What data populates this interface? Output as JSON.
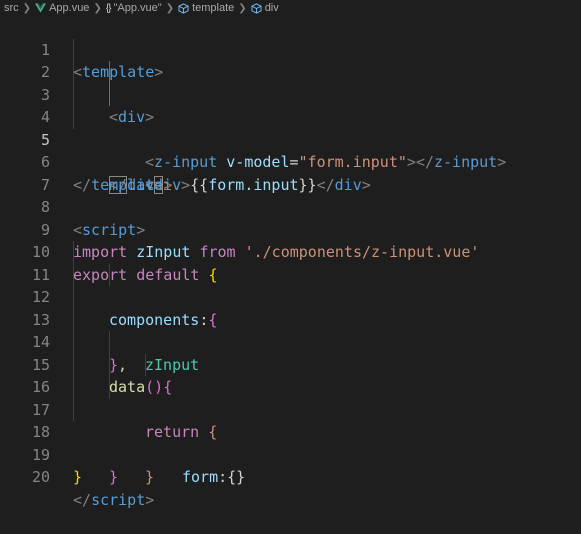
{
  "breadcrumb": {
    "items": [
      "src",
      "App.vue",
      "\"App.vue\"",
      "template",
      "div"
    ]
  },
  "editor": {
    "line_numbers": [
      "1",
      "2",
      "3",
      "4",
      "5",
      "6",
      "7",
      "8",
      "9",
      "10",
      "11",
      "12",
      "13",
      "14",
      "15",
      "16",
      "17",
      "18",
      "19",
      "20"
    ],
    "current_line": 5,
    "tokens": {
      "l1_open": "<",
      "l1_tag": "template",
      "l1_close": ">",
      "l2_open": "<",
      "l2_tag": "div",
      "l2_close": ">",
      "l3_open": "<",
      "l3_tag": "z-input",
      "l3_attr": "v-model",
      "l3_eq": "=",
      "l3_val": "\"form.input\"",
      "l3_gt": ">",
      "l3_endopen": "</",
      "l3_endtag": "z-input",
      "l3_endgt": ">",
      "l4_open": "<",
      "l4_tag": "div",
      "l4_gt": ">",
      "l4_mustache_open": "{{",
      "l4_expr": "form.input",
      "l4_mustache_close": "}}",
      "l4_endopen": "</",
      "l4_endtag": "div",
      "l4_endgt": ">",
      "l5_open": "</",
      "l5_tag": "div",
      "l5_close": ">",
      "l6_open": "</",
      "l6_tag": "template",
      "l6_close": ">",
      "l8_open": "<",
      "l8_tag": "script",
      "l8_close": ">",
      "l9_import": "import",
      "l9_name": "zInput",
      "l9_from": "from",
      "l9_path": "'./components/z-input.vue'",
      "l10_export": "export",
      "l10_default": "default",
      "l10_brace": "{",
      "l11_key": "components",
      "l11_colon": ":",
      "l11_brace": "{",
      "l12_val": "zInput",
      "l13_brace": "}",
      "l13_comma": ",",
      "l14_fn": "data",
      "l14_parens": "()",
      "l14_brace": "{",
      "l15_return": "return",
      "l15_brace": "{",
      "l16_key": "form",
      "l16_colon": ":",
      "l16_braces": "{}",
      "l17_brace": "}",
      "l18_brace": "}",
      "l19_brace": "}",
      "l20_open": "</",
      "l20_tag": "script",
      "l20_close": ">"
    }
  },
  "colors": {
    "background": "#1e1e1e",
    "tag": "#569cd6",
    "attribute": "#9cdcfe",
    "string": "#ce9178",
    "keyword": "#c586c0",
    "bracket_level1": "#ffd700",
    "bracket_level2": "#da70d6",
    "bracket_level3": "#179fff"
  },
  "icons": {
    "vue_file": "vue-logo-icon",
    "braces": "braces-icon",
    "element": "cube-icon"
  }
}
